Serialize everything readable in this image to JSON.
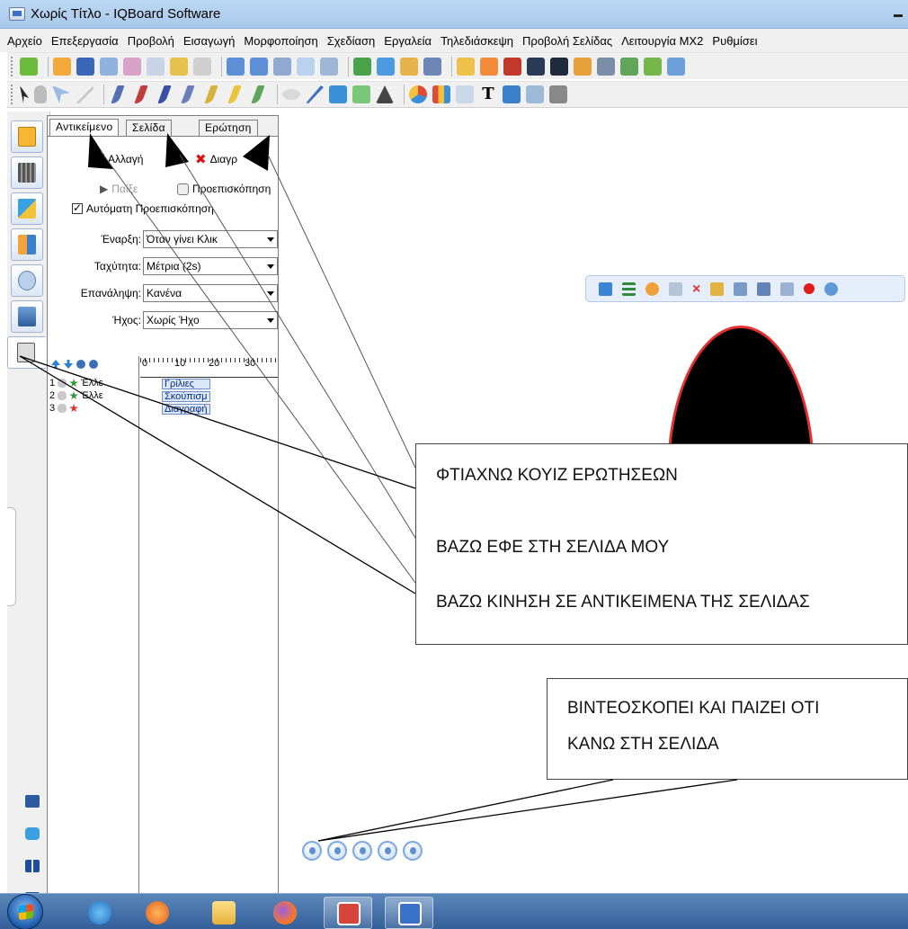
{
  "window": {
    "title": "Χωρίς Τίτλο - IQBoard Software"
  },
  "menubar": {
    "items": [
      "Αρχείο",
      "Επεξεργασία",
      "Προβολή",
      "Εισαγωγή",
      "Μορφοποίηση",
      "Σχεδίαση",
      "Εργαλεία",
      "Τηλεδιάσκεψη",
      "Προβολή Σελίδας",
      "Λειτουργία MX2",
      "Ρυθμίσει"
    ]
  },
  "panel": {
    "tabs": [
      "Αντικείμενο",
      "Σελίδα",
      "Ερώτηση"
    ],
    "change_label": "Αλλαγή",
    "delete_label": "Διαγρ",
    "play_label": "Παίξε",
    "preview_label": "Προεπισκόπηση",
    "auto_preview_label": "Αυτόματη Προεπισκόπηση",
    "auto_preview_checked": true,
    "fields": {
      "start": {
        "label": "Έναρξη:",
        "value": "Όταν γίνει Κλικ"
      },
      "speed": {
        "label": "Ταχύτητα:",
        "value": "Μέτρια (2s)"
      },
      "repeat": {
        "label": "Επανάληψη:",
        "value": "Κανένα"
      },
      "sound": {
        "label": "Ήχος:",
        "value": "Χωρίς Ήχο"
      }
    },
    "ruler_ticks": [
      "0",
      "10",
      "20",
      "30"
    ],
    "animations": [
      {
        "index": "1",
        "name": "Έλλε",
        "effect": "Γρίλιες"
      },
      {
        "index": "2",
        "name": "Έλλε",
        "effect": "Σκούπισμ"
      },
      {
        "index": "3",
        "name": "",
        "effect": "Διαγραφή"
      }
    ]
  },
  "callouts": {
    "quiz": "ΦΤΙΑΧΝΩ ΚΟΥΙΖ ΕΡΩΤΗΣΕΩΝ",
    "page_effect": "ΒΑΖΩ ΕΦΕ ΣΤΗ ΣΕΛΙΔΑ ΜΟΥ",
    "object_motion": "ΒΑΖΩ ΚΙΝΗΣΗ ΣΕ ΑΝΤΙΚΕΙΜΕΝΑ ΤΗΣ ΣΕΛΙΔΑΣ",
    "record_line1": "ΒΙΝΤΕΟΣΚΟΠΕΙ ΚΑΙ ΠΑΙΖΕΙ ΟΤΙ",
    "record_line2": "ΚΑΝΩ ΣΤΗ ΣΕΛΙΔΑ"
  },
  "canvas": {
    "shape_fill": "#000000",
    "shape_stroke": "#e2312e"
  },
  "colors": {
    "titlebar": "#b4d1f0",
    "toolbar_bg": "#f0f0f0",
    "taskbar": "#3f6aa3",
    "accent_blue": "#3a72c9"
  }
}
